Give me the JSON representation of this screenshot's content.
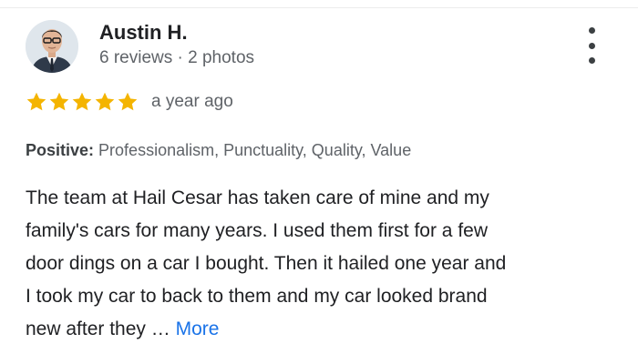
{
  "reviewer": {
    "name": "Austin H.",
    "meta": "6 reviews · 2 photos"
  },
  "rating": {
    "stars": 5,
    "max_stars": 5,
    "star_color": "#f4b400",
    "date": "a year ago"
  },
  "attributes": {
    "label": "Positive:",
    "values": "Professionalism, Punctuality, Quality, Value"
  },
  "review": {
    "lines": [
      "The team at Hail Cesar has taken care of mine and my",
      "family's cars for many years. I used them first for a few",
      "door dings on a car I bought. Then it hailed one year and",
      "I took my car to back to them and my car looked brand",
      "new after they …"
    ],
    "more_label": "More",
    "more_color": "#1a73e8"
  },
  "icons": {
    "menu": "more-vert-icon",
    "star": "star-icon"
  }
}
